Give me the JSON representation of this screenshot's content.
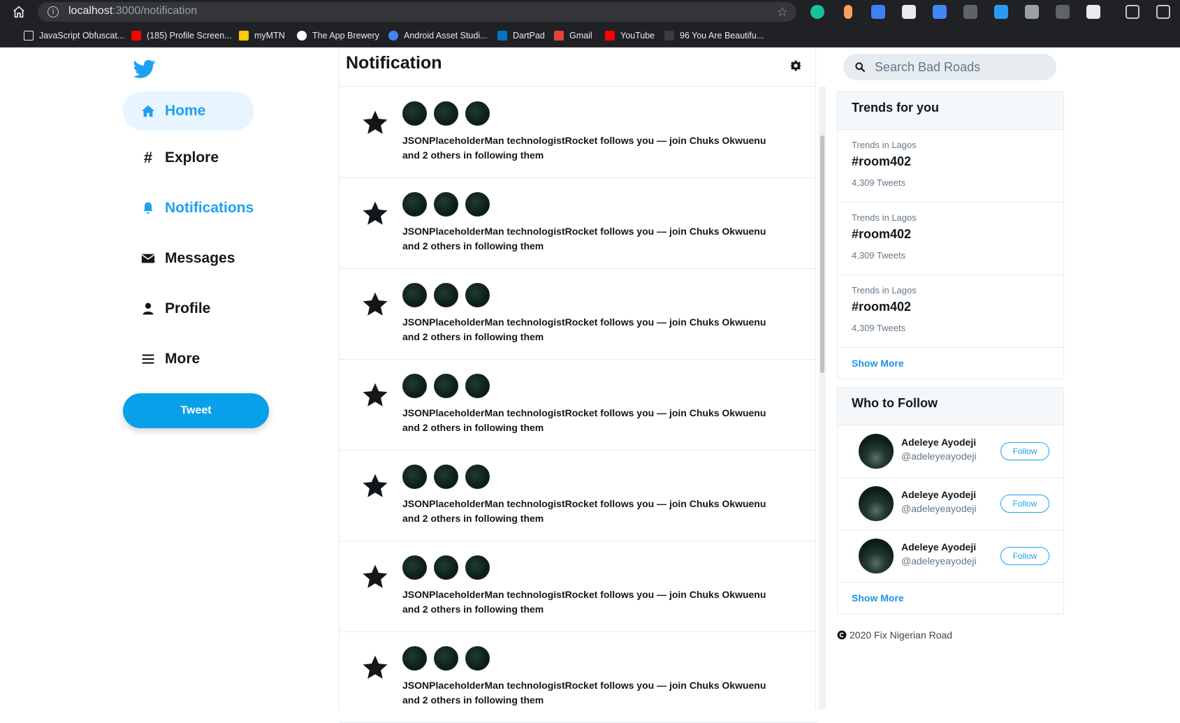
{
  "browser": {
    "url_host": "localhost",
    "url_path": ":3000/notification",
    "bookmarks": [
      {
        "label": "JavaScript Obfuscat...",
        "icon": "page-icon",
        "color": "#ffffff"
      },
      {
        "label": "(185) Profile Screen...",
        "icon": "youtube-icon",
        "color": "#ff0000"
      },
      {
        "label": "myMTN",
        "icon": "mtn-icon",
        "color": "#ffcc00"
      },
      {
        "label": "The App Brewery",
        "icon": "brewery-icon",
        "color": "#ffffff"
      },
      {
        "label": "Android Asset Studi...",
        "icon": "android-studio-icon",
        "color": "#4285f4"
      },
      {
        "label": "DartPad",
        "icon": "dart-icon",
        "color": "#0175c2"
      },
      {
        "label": "Gmail",
        "icon": "gmail-icon",
        "color": "#ea4335"
      },
      {
        "label": "YouTube",
        "icon": "youtube-icon",
        "color": "#ff0000"
      },
      {
        "label": "96 You Are Beautifu...",
        "icon": "music-icon",
        "color": "#3c3c3c"
      }
    ]
  },
  "nav": {
    "home": "Home",
    "explore": "Explore",
    "notifications": "Notifications",
    "messages": "Messages",
    "profile": "Profile",
    "more": "More",
    "tweet": "Tweet"
  },
  "main": {
    "title": "Notification",
    "notifications": [
      {
        "text": "JSONPlaceholderMan technologistRocket follows you — join Chuks Okwuenu and 2 others in following them"
      },
      {
        "text": "JSONPlaceholderMan technologistRocket follows you — join Chuks Okwuenu and 2 others in following them"
      },
      {
        "text": "JSONPlaceholderMan technologistRocket follows you — join Chuks Okwuenu and 2 others in following them"
      },
      {
        "text": "JSONPlaceholderMan technologistRocket follows you — join Chuks Okwuenu and 2 others in following them"
      },
      {
        "text": "JSONPlaceholderMan technologistRocket follows you — join Chuks Okwuenu and 2 others in following them"
      },
      {
        "text": "JSONPlaceholderMan technologistRocket follows you — join Chuks Okwuenu and 2 others in following them"
      },
      {
        "text": "JSONPlaceholderMan technologistRocket follows you — join Chuks Okwuenu and 2 others in following them"
      }
    ]
  },
  "sidebar": {
    "search_placeholder": "Search Bad Roads",
    "trends_title": "Trends for you",
    "trends": [
      {
        "location": "Trends in Lagos",
        "tag": "#room402",
        "count": "4,309 Tweets"
      },
      {
        "location": "Trends in Lagos",
        "tag": "#room402",
        "count": "4,309 Tweets"
      },
      {
        "location": "Trends in Lagos",
        "tag": "#room402",
        "count": "4,309 Tweets"
      }
    ],
    "trends_show_more": "Show More",
    "who_title": "Who to Follow",
    "who": [
      {
        "name": "Adeleye Ayodeji",
        "handle": "@adeleyeayodeji",
        "button": "Follow"
      },
      {
        "name": "Adeleye Ayodeji",
        "handle": "@adeleyeayodeji",
        "button": "Follow"
      },
      {
        "name": "Adeleye Ayodeji",
        "handle": "@adeleyeayodeji",
        "button": "Follow"
      }
    ],
    "who_show_more": "Show More",
    "footer": "2020 Fix Nigerian Road"
  },
  "colors": {
    "accent": "#1da1f2",
    "tweet_button": "#08a0e9",
    "home_active_bg": "#e8f5fe"
  }
}
